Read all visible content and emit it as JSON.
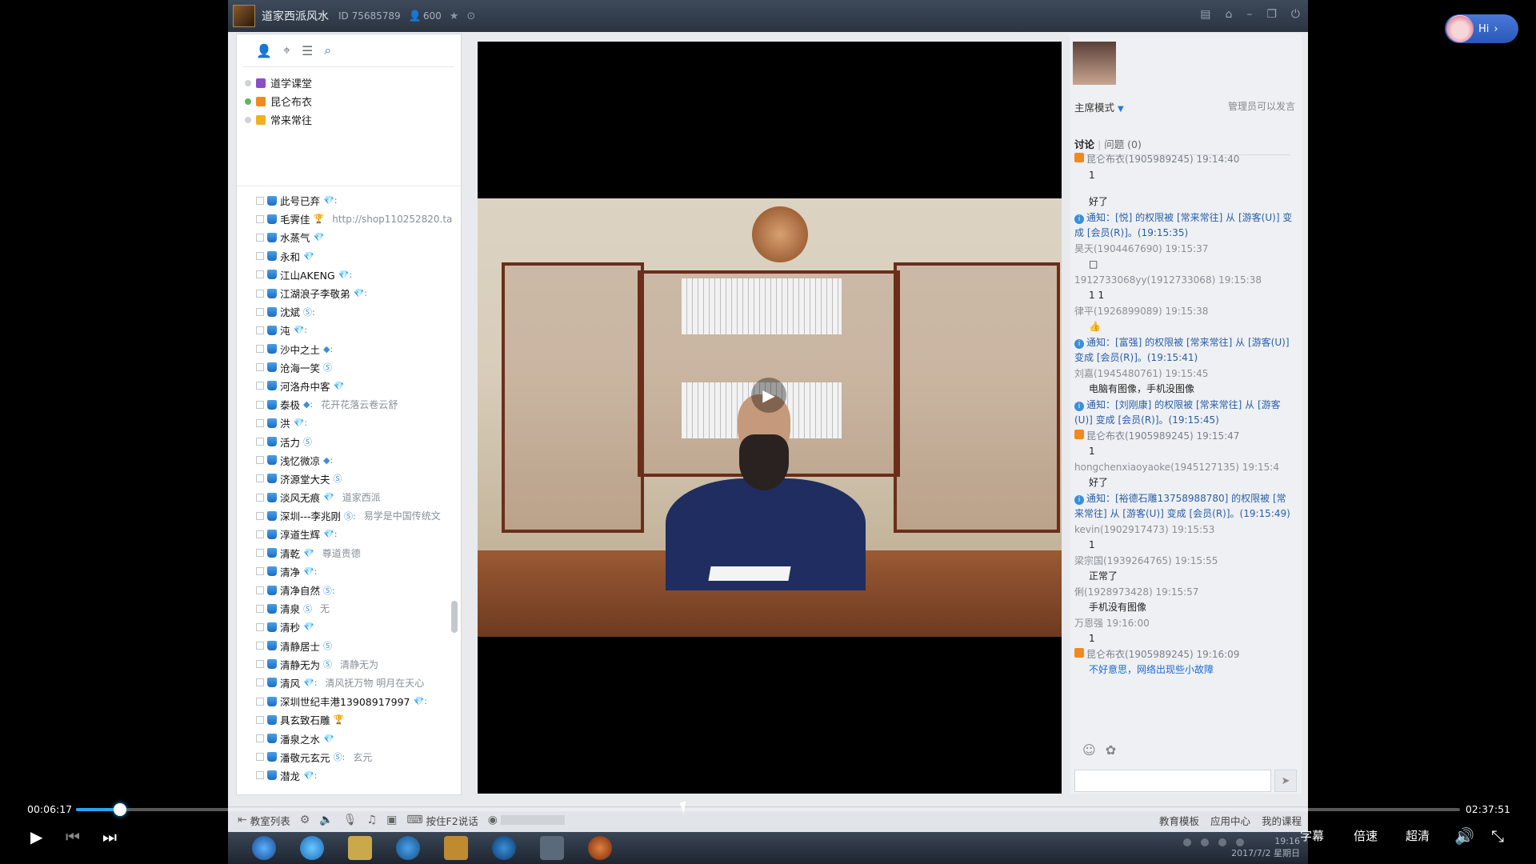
{
  "window": {
    "title": "道家西派风水",
    "room_id": "ID 75685789",
    "online_count": "600",
    "controls": [
      "skin-icon",
      "mini-icon",
      "minimize-icon",
      "restore-icon",
      "close-icon"
    ]
  },
  "left_panel": {
    "groups": [
      {
        "label": "道学课堂",
        "color": "#8b4fc8",
        "online": false
      },
      {
        "label": "昆仑布衣",
        "color": "#f08a20",
        "online": true
      },
      {
        "label": "常来常往",
        "color": "#f0b020",
        "online": false
      }
    ],
    "users": [
      {
        "name": "此号已弃",
        "badge": "💎:",
        "sig": ""
      },
      {
        "name": "毛霁佳",
        "badge": "🏆",
        "sig": "http://shop110252820.ta"
      },
      {
        "name": "水蒸气",
        "badge": "💎",
        "sig": ""
      },
      {
        "name": "永和",
        "badge": "💎",
        "sig": ""
      },
      {
        "name": "江山AKENG",
        "badge": "💎:",
        "sig": ""
      },
      {
        "name": "江湖浪子李敬弟",
        "badge": "💎:",
        "sig": ""
      },
      {
        "name": "沈斌",
        "badge": "Ⓢ:",
        "sig": ""
      },
      {
        "name": "沌",
        "badge": "💎:",
        "sig": ""
      },
      {
        "name": "沙中之土",
        "badge": "◆:",
        "sig": ""
      },
      {
        "name": "沧海一笑",
        "badge": "Ⓢ",
        "sig": ""
      },
      {
        "name": "河洛舟中客",
        "badge": "💎",
        "sig": ""
      },
      {
        "name": "泰极",
        "badge": "◆:",
        "sig": "花开花落云卷云舒"
      },
      {
        "name": "洪",
        "badge": "💎:",
        "sig": ""
      },
      {
        "name": "活力",
        "badge": "Ⓢ",
        "sig": ""
      },
      {
        "name": "浅忆微凉",
        "badge": "◆:",
        "sig": ""
      },
      {
        "name": "济源堂大夫",
        "badge": "Ⓢ",
        "sig": ""
      },
      {
        "name": "淡风无痕",
        "badge": "💎",
        "sig": "道家西派"
      },
      {
        "name": "深圳---李兆刚",
        "badge": "Ⓢ:",
        "sig": "易学是中国传统文"
      },
      {
        "name": "淳道生辉",
        "badge": "💎:",
        "sig": ""
      },
      {
        "name": "清乾",
        "badge": "💎",
        "sig": "尊道贵德"
      },
      {
        "name": "清净",
        "badge": "💎:",
        "sig": ""
      },
      {
        "name": "清净自然",
        "badge": "Ⓢ:",
        "sig": ""
      },
      {
        "name": "清泉",
        "badge": "Ⓢ",
        "sig": "无"
      },
      {
        "name": "清秒",
        "badge": "💎",
        "sig": ""
      },
      {
        "name": "清静居士",
        "badge": "Ⓢ",
        "sig": ""
      },
      {
        "name": "清静无为",
        "badge": "Ⓢ",
        "sig": "清静无为"
      },
      {
        "name": "清风",
        "badge": "💎:",
        "sig": "清风抚万物  明月在天心"
      },
      {
        "name": "深圳世纪丰港13908917997",
        "badge": "💎:",
        "sig": ""
      },
      {
        "name": "具玄致石雕",
        "badge": "🏆",
        "sig": ""
      },
      {
        "name": "潘泉之水",
        "badge": "💎",
        "sig": ""
      },
      {
        "name": "潘敬元玄元",
        "badge": "Ⓢ:",
        "sig": "玄元"
      },
      {
        "name": "潜龙",
        "badge": "💎:",
        "sig": ""
      }
    ]
  },
  "right_panel": {
    "mode": "主席模式",
    "admin_note": "管理员可以发言",
    "tabs": [
      {
        "label": "讨论"
      },
      {
        "label": "问题 (0)"
      }
    ],
    "messages": [
      {
        "type": "chat",
        "header": "昆仑布衣(1905989245) 19:14:40",
        "body": "1",
        "staff": true
      },
      {
        "type": "spacer"
      },
      {
        "type": "chat",
        "header": "",
        "body": "好了"
      },
      {
        "type": "notice",
        "body": "通知：[悦] 的权限被 [常来常往] 从 [游客(U)] 变成 [会员(R)]。(19:15:35)"
      },
      {
        "type": "chat",
        "header": "昊天(1904467690) 19:15:37",
        "body": "□"
      },
      {
        "type": "chat",
        "header": "1912733068yy(1912733068) 19:15:38",
        "body": "1 1"
      },
      {
        "type": "chat",
        "header": "律平(1926899089) 19:15:38",
        "body": "👍"
      },
      {
        "type": "notice",
        "body": "通知：[富强] 的权限被 [常来常往] 从 [游客(U)] 变成 [会员(R)]。(19:15:41)"
      },
      {
        "type": "chat",
        "header": "刘嘉(1945480761) 19:15:45",
        "body": "电脑有图像，手机没图像"
      },
      {
        "type": "notice",
        "body": "通知：[刘刚康] 的权限被 [常来常往] 从 [游客(U)] 变成 [会员(R)]。(19:15:45)"
      },
      {
        "type": "chat",
        "header": "昆仑布衣(1905989245) 19:15:47",
        "body": "1",
        "staff": true
      },
      {
        "type": "chat",
        "header": "hongchenxiaoyaoke(1945127135) 19:15:4",
        "body": "好了"
      },
      {
        "type": "notice",
        "body": "通知：[裕德石雕13758988780] 的权限被 [常来常往] 从 [游客(U)] 变成 [会员(R)]。(19:15:49)"
      },
      {
        "type": "chat",
        "header": "kevin(1902917473) 19:15:53",
        "body": "1"
      },
      {
        "type": "chat",
        "header": "梁宗国(1939264765) 19:15:55",
        "body": "正常了"
      },
      {
        "type": "chat",
        "header": "俐(1928973428) 19:15:57",
        "body": "手机没有图像"
      },
      {
        "type": "chat",
        "header": "万恩强 19:16:00",
        "body": "1"
      },
      {
        "type": "chat",
        "header": "昆仑布衣(1905989245) 19:16:09",
        "body": "不好意思，网络出现些小故障",
        "staff": true,
        "blue": true
      }
    ]
  },
  "bottom_bar": {
    "items": [
      "教室列表",
      "按住F2说话"
    ],
    "right_items": [
      "教育模板",
      "应用中心",
      "我的课程"
    ]
  },
  "taskbar": {
    "time": "19:16",
    "date": "2017/7/2 星期日"
  },
  "assistant": {
    "label": "Hi"
  },
  "player": {
    "current_time": "00:06:17",
    "total_time": "02:37:51",
    "progress": 0.032,
    "buttons": {
      "subtitle": "字幕",
      "speed": "倍速",
      "quality": "超清"
    }
  }
}
